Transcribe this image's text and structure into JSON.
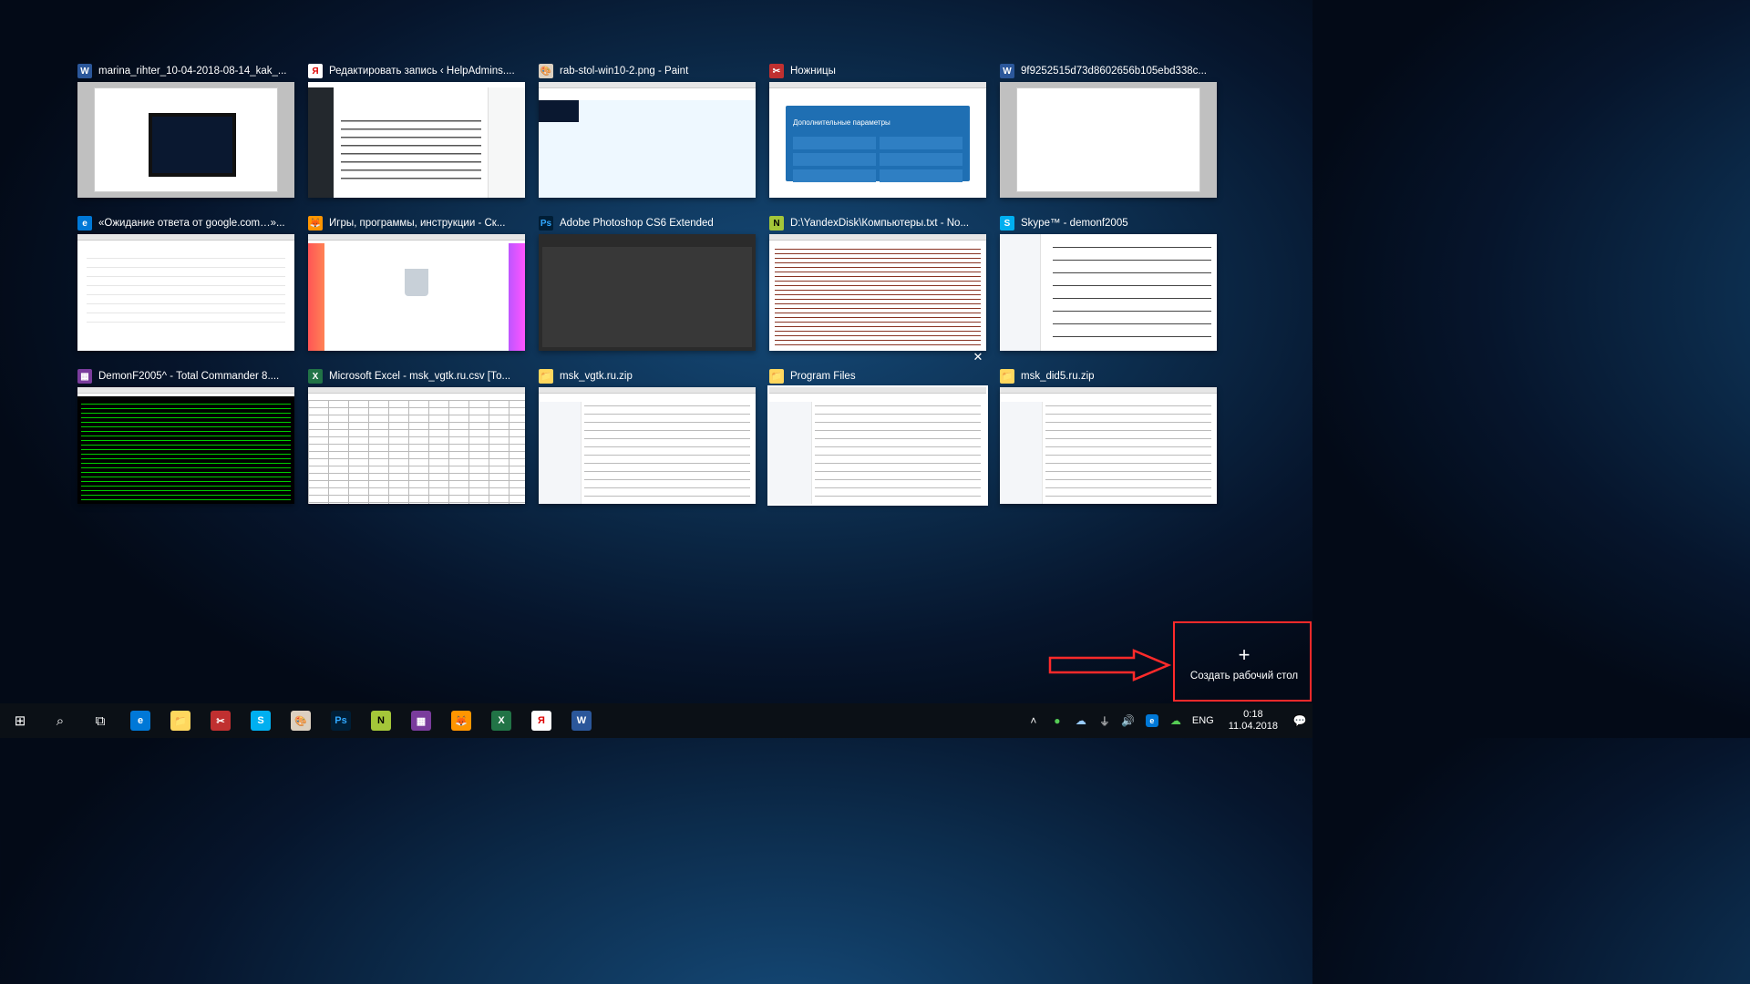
{
  "windows": [
    {
      "id": "w-word1",
      "icon": "word",
      "title": "marina_rihter_10-04-2018-08-14_kak_..."
    },
    {
      "id": "w-yandex",
      "icon": "yandex",
      "title": "Редактировать запись ‹ HelpAdmins...."
    },
    {
      "id": "w-paint",
      "icon": "paint",
      "title": "rab-stol-win10-2.png - Paint"
    },
    {
      "id": "w-snip",
      "icon": "snip",
      "title": "Ножницы"
    },
    {
      "id": "w-word2",
      "icon": "word",
      "title": "9f9252515d73d8602656b105ebd338c..."
    },
    {
      "id": "w-edge",
      "icon": "edge",
      "title": "«Ожидание ответа от google.com…»..."
    },
    {
      "id": "w-ff",
      "icon": "ff",
      "title": "Игры, программы, инструкции - Ск..."
    },
    {
      "id": "w-ps",
      "icon": "ps",
      "title": "Adobe Photoshop CS6 Extended"
    },
    {
      "id": "w-npp",
      "icon": "npp",
      "title": "D:\\YandexDisk\\Компьютеры.txt - No..."
    },
    {
      "id": "w-skype",
      "icon": "sk",
      "title": "Skype™ - demonf2005"
    },
    {
      "id": "w-tc",
      "icon": "tc",
      "title": "DemonF2005^ - Total Commander 8...."
    },
    {
      "id": "w-xl",
      "icon": "xl",
      "title": "Microsoft Excel - msk_vgtk.ru.csv  [То..."
    },
    {
      "id": "w-z1",
      "icon": "fld",
      "title": "msk_vgtk.ru.zip"
    },
    {
      "id": "w-z2",
      "icon": "fld",
      "title": "Program Files",
      "selected": true
    },
    {
      "id": "w-z3",
      "icon": "fld",
      "title": "msk_did5.ru.zip"
    }
  ],
  "snip_panel_title": "Дополнительные параметры",
  "new_desktop_label": "Создать рабочий стол",
  "taskbar_apps": [
    {
      "name": "start",
      "glyph": "⊞"
    },
    {
      "name": "search",
      "glyph": "⌕"
    },
    {
      "name": "taskview",
      "glyph": "⧉"
    },
    {
      "name": "edge",
      "cls": "i-edge"
    },
    {
      "name": "explorer",
      "cls": "i-fld"
    },
    {
      "name": "snip",
      "cls": "i-snip"
    },
    {
      "name": "skype",
      "cls": "i-sk"
    },
    {
      "name": "paint",
      "cls": "i-paint"
    },
    {
      "name": "photoshop",
      "cls": "i-ps"
    },
    {
      "name": "notepadpp",
      "cls": "i-npp"
    },
    {
      "name": "totalcmd",
      "cls": "i-tc"
    },
    {
      "name": "firefox",
      "cls": "i-ff"
    },
    {
      "name": "excel",
      "cls": "i-xl"
    },
    {
      "name": "yandex",
      "cls": "i-yandex"
    },
    {
      "name": "word",
      "cls": "i-word"
    }
  ],
  "tray": {
    "lang": "ENG",
    "time": "0:18",
    "date": "11.04.2018"
  }
}
